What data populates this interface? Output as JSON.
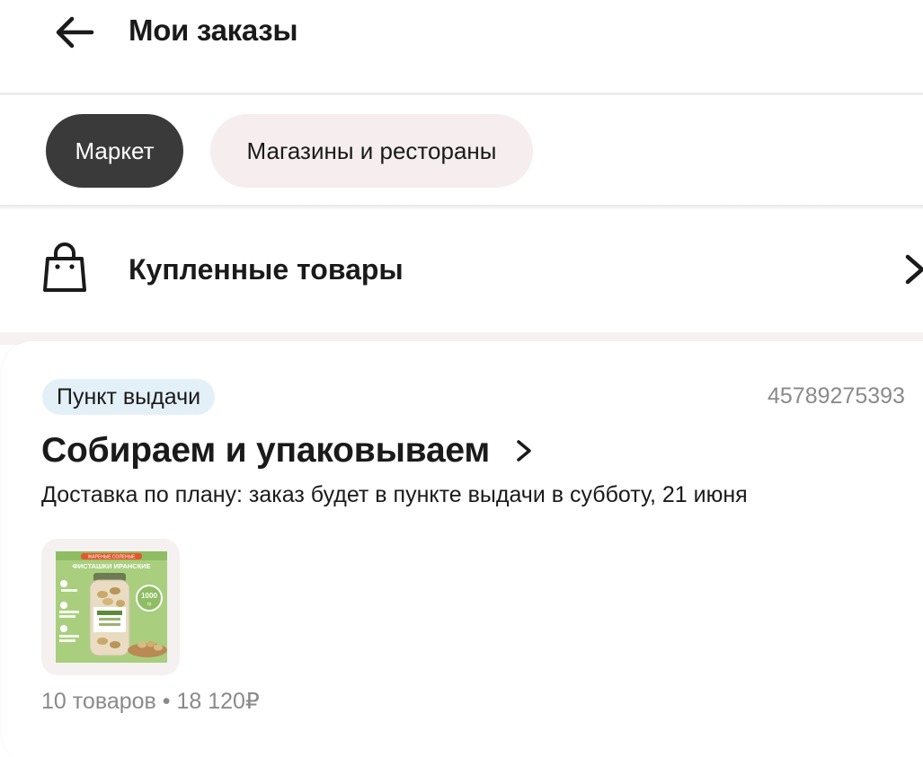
{
  "header": {
    "back_icon": "arrow-left-icon",
    "title": "Мои заказы"
  },
  "tabs": [
    {
      "label": "Маркет",
      "active": true
    },
    {
      "label": "Магазины и рестораны",
      "active": false
    }
  ],
  "purchased": {
    "icon": "shopping-bag-icon",
    "label": "Купленные товары",
    "chevron_icon": "chevron-right-icon"
  },
  "order": {
    "badge": "Пункт выдачи",
    "number": "45789275393",
    "status": "Собираем и упаковываем",
    "delivery": "Доставка по плану: заказ будет в пункте выдачи в субботу, 21 июня",
    "product": {
      "banner": "ЖАРЕНЫЕ СОЛЕНЫЕ",
      "title": "ФИСТАШКИ ИРАНСКИЕ",
      "weight_value": "1000",
      "weight_unit": "гр"
    },
    "summary": "10 товаров • 18 120₽"
  },
  "colors": {
    "active_tab_bg": "#3a3a3a",
    "inactive_tab_bg": "#f6eeee",
    "badge_bg": "#e4f0f8",
    "muted_text": "#8a8a8a"
  }
}
